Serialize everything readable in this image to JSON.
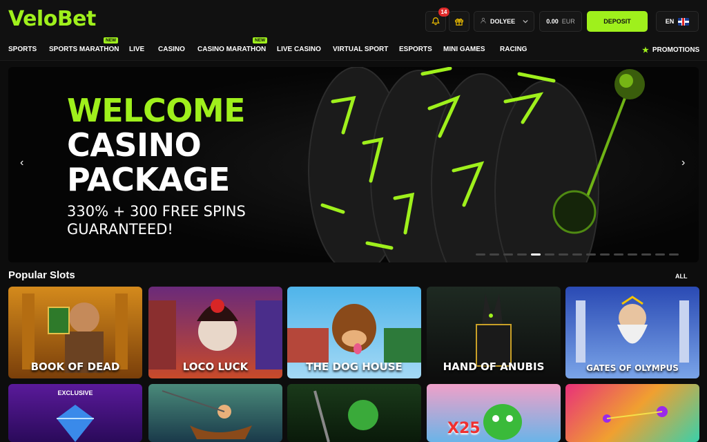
{
  "header": {
    "logo": "VeloBet",
    "notifications_count": "14",
    "username": "DOLYEE",
    "balance_amount": "0.00",
    "balance_currency": "EUR",
    "deposit_label": "DEPOSIT",
    "language": "EN"
  },
  "nav": {
    "items": [
      "SPORTS",
      "SPORTS MARATHON",
      "LIVE",
      "CASINO",
      "CASINO MARATHON",
      "LIVE CASINO",
      "VIRTUAL SPORT",
      "ESPORTS",
      "MINI GAMES",
      "RACING"
    ],
    "new_tag": "NEW",
    "promotions": "PROMOTIONS"
  },
  "banner": {
    "line1": "WELCOME",
    "line2": "CASINO",
    "line3": "PACKAGE",
    "line4": "330% + 300 FREE SPINS",
    "line5": "GUARANTEED!",
    "slide_count": 15,
    "active_slide": 5
  },
  "popular_slots": {
    "title": "Popular Slots",
    "all_label": "ALL",
    "row1": [
      "BOOK OF DEAD",
      "LOCO LUCK",
      "THE DOG HOUSE",
      "HAND OF ANUBIS",
      "GATES OF OLYMPUS"
    ],
    "exclusive_label": "EXCLUSIVE",
    "x25_label": "X25"
  },
  "colors": {
    "accent": "#9ff01c",
    "background": "#0d0d0d",
    "badge": "#e02a2a"
  },
  "icons": [
    "bell-icon",
    "gift-icon",
    "user-icon",
    "chevron-down-icon",
    "star-icon",
    "arrow-left-icon",
    "arrow-right-icon",
    "flag-uk-icon"
  ]
}
